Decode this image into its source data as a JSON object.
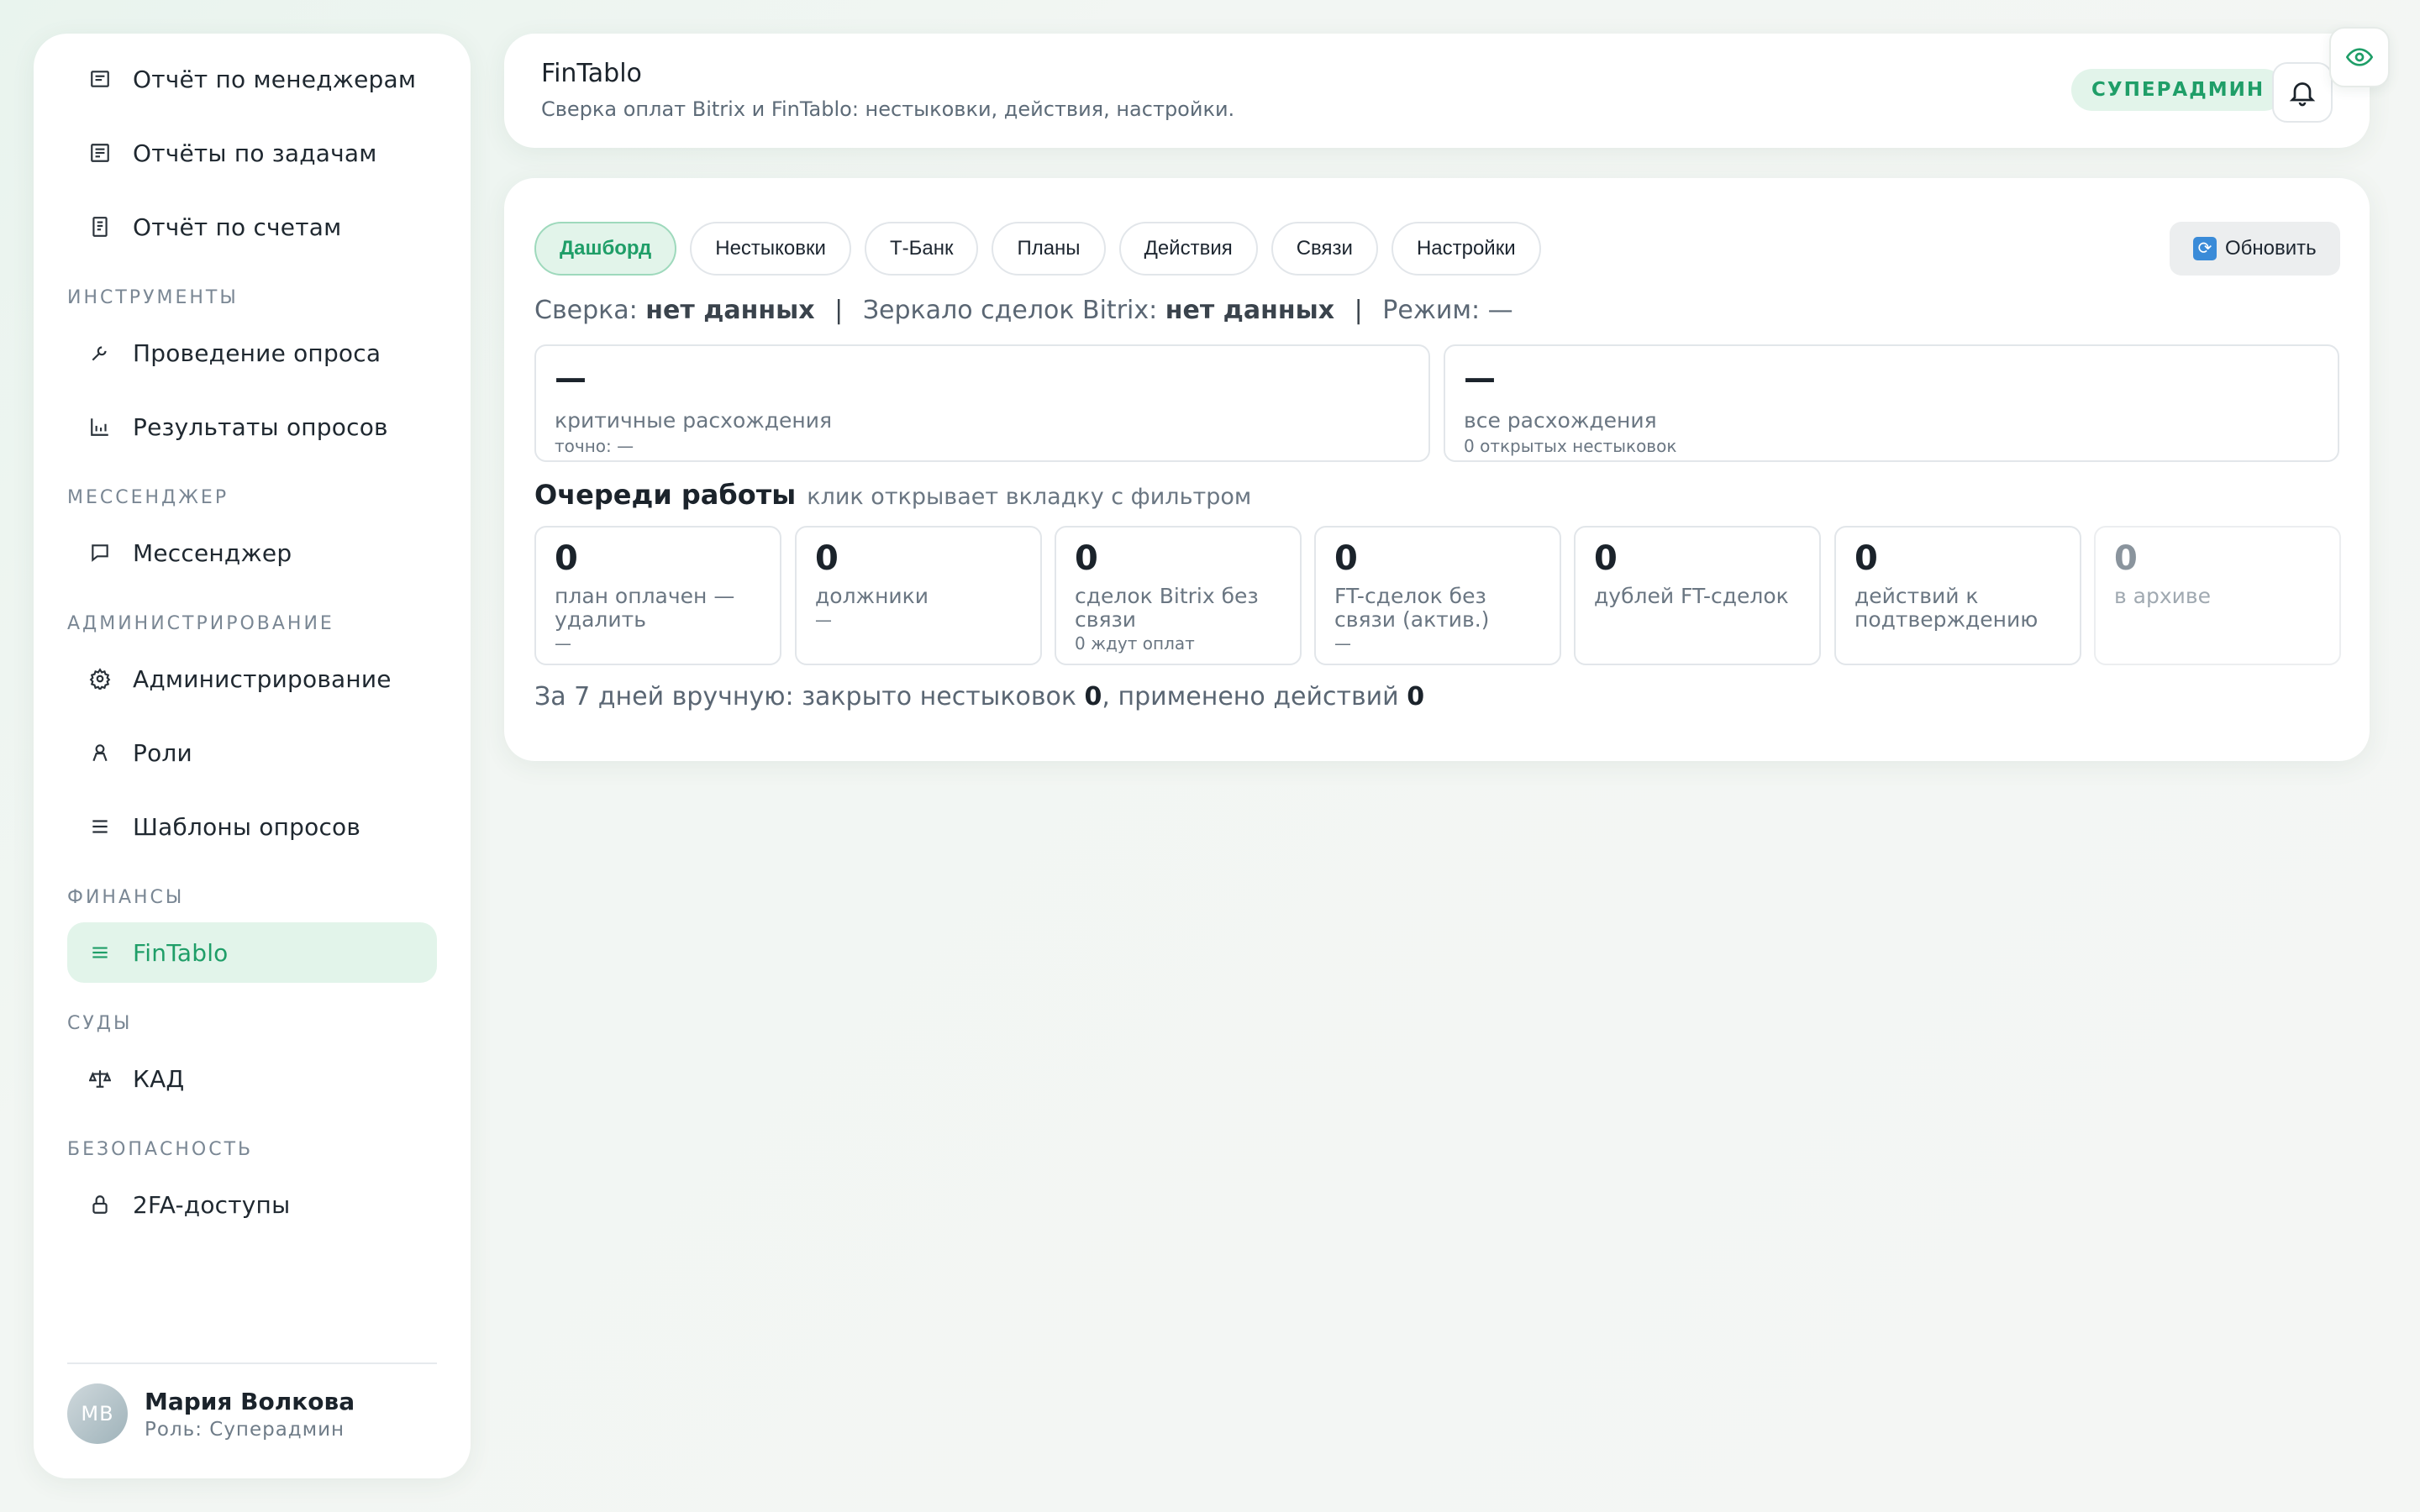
{
  "sidebar": {
    "top_items": [
      {
        "label": "Отчёт по менеджерам",
        "icon": "report-icon"
      },
      {
        "label": "Отчёты по задачам",
        "icon": "tasks-report-icon"
      },
      {
        "label": "Отчёт по счетам",
        "icon": "invoice-icon"
      }
    ],
    "sections": [
      {
        "title": "ИНСТРУМЕНТЫ",
        "items": [
          {
            "label": "Проведение опроса",
            "icon": "wrench-icon"
          },
          {
            "label": "Результаты опросов",
            "icon": "bar-chart-icon"
          }
        ]
      },
      {
        "title": "МЕССЕНДЖЕР",
        "items": [
          {
            "label": "Мессенджер",
            "icon": "chat-icon"
          }
        ]
      },
      {
        "title": "АДМИНИСТРИРОВАНИЕ",
        "items": [
          {
            "label": "Администрирование",
            "icon": "gear-icon"
          },
          {
            "label": "Роли",
            "icon": "user-icon"
          },
          {
            "label": "Шаблоны опросов",
            "icon": "list-icon"
          }
        ]
      },
      {
        "title": "ФИНАНСЫ",
        "items": [
          {
            "label": "FinTablo",
            "icon": "menu-icon",
            "active": true
          }
        ]
      },
      {
        "title": "СУДЫ",
        "items": [
          {
            "label": "КАД",
            "icon": "scales-icon"
          }
        ]
      },
      {
        "title": "БЕЗОПАСНОСТЬ",
        "items": [
          {
            "label": "2FA-доступы",
            "icon": "lock-icon"
          }
        ]
      }
    ],
    "user": {
      "initials": "МВ",
      "name": "Мария Волкова",
      "role": "Роль: Суперадмин"
    }
  },
  "header": {
    "title": "FinTablo",
    "subtitle": "Сверка оплат Bitrix и FinTablo: нестыковки, действия, настройки.",
    "role_badge": "СУПЕРАДМИН"
  },
  "tabs": [
    "Дашборд",
    "Нестыковки",
    "Т-Банк",
    "Планы",
    "Действия",
    "Связи",
    "Настройки"
  ],
  "active_tab": "Дашборд",
  "refresh_label": "Обновить",
  "status": {
    "sverka_label": "Сверка:",
    "sverka_value": "нет данных",
    "mirror_label": "Зеркало сделок Bitrix:",
    "mirror_value": "нет данных",
    "mode_label": "Режим:",
    "mode_value": "—",
    "separator": "|"
  },
  "kpis": [
    {
      "value": "—",
      "label": "критичные расхождения",
      "sub": "точно: —"
    },
    {
      "value": "—",
      "label": "все расхождения",
      "sub": "0 открытых нестыковок"
    }
  ],
  "queues_title": "Очереди работы",
  "queues_hint": "клик открывает вкладку с фильтром",
  "queues": [
    {
      "value": "0",
      "label": "план оплачен — удалить",
      "sub": "—"
    },
    {
      "value": "0",
      "label": "должники",
      "sub": "—"
    },
    {
      "value": "0",
      "label": "сделок Bitrix без связи",
      "sub": "0 ждут оплат"
    },
    {
      "value": "0",
      "label": "FT-сделок без связи (актив.)",
      "sub": "—"
    },
    {
      "value": "0",
      "label": "дублей FT-сделок",
      "sub": ""
    },
    {
      "value": "0",
      "label": "действий к подтверждению",
      "sub": ""
    },
    {
      "value": "0",
      "label": "в архиве",
      "sub": "",
      "muted": true
    }
  ],
  "footer": {
    "prefix": "За 7 дней вручную: закрыто нестыковок",
    "closed": "0",
    "middle": ", применено действий",
    "applied": "0"
  },
  "colors": {
    "accent": "#1f9e68",
    "accent_bg": "#e2f4ea"
  }
}
